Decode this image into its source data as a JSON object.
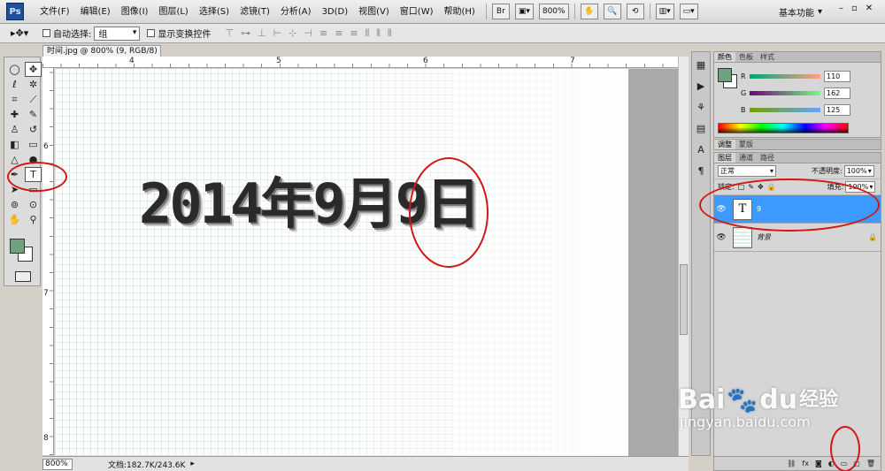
{
  "app": {
    "logo": "Ps"
  },
  "menu": [
    "文件(F)",
    "编辑(E)",
    "图像(I)",
    "图层(L)",
    "选择(S)",
    "滤镜(T)",
    "分析(A)",
    "3D(D)",
    "视图(V)",
    "窗口(W)",
    "帮助(H)"
  ],
  "menubar": {
    "bridge": "Br",
    "zoom": "800%",
    "workspace": "基本功能",
    "win_min": "–",
    "win_restore": "▫",
    "win_close": "✕"
  },
  "options": {
    "auto_select": "自动选择:",
    "auto_select_value": "组",
    "show_transform": "显示变换控件"
  },
  "document": {
    "tab_title": "时间.jpg @ 800% (9, RGB/8) *",
    "canvas_text": "2014年9月9日"
  },
  "rulers": {
    "top": [
      "4",
      "5",
      "6",
      "7"
    ],
    "left": [
      "6",
      "7",
      "8"
    ]
  },
  "status": {
    "zoom": "800%",
    "doc_info": "文档:182.7K/243.6K"
  },
  "color_panel": {
    "tabs": [
      "颜色",
      "色板",
      "样式"
    ],
    "r_label": "R",
    "r": "110",
    "g_label": "G",
    "g": "162",
    "b_label": "B",
    "b": "125",
    "fg_color": "#6ea27d"
  },
  "adjust_panel": {
    "tabs": [
      "调整",
      "蒙版"
    ]
  },
  "layers_panel": {
    "tabs": [
      "图层",
      "通道",
      "路径"
    ],
    "blend_mode": "正常",
    "opacity_label": "不透明度:",
    "opacity": "100%",
    "lock_label": "锁定:",
    "fill_label": "填充:",
    "fill": "100%",
    "layers": [
      {
        "name": "9",
        "thumb": "T"
      },
      {
        "name": "背景"
      }
    ]
  },
  "watermark": {
    "main": "Bai",
    "paw": "🐾",
    "du": "du",
    "cn": "经验",
    "url": "jingyan.baidu.com"
  },
  "colors": {
    "accent_blue": "#3d9bff",
    "annotation_red": "#d01818"
  }
}
